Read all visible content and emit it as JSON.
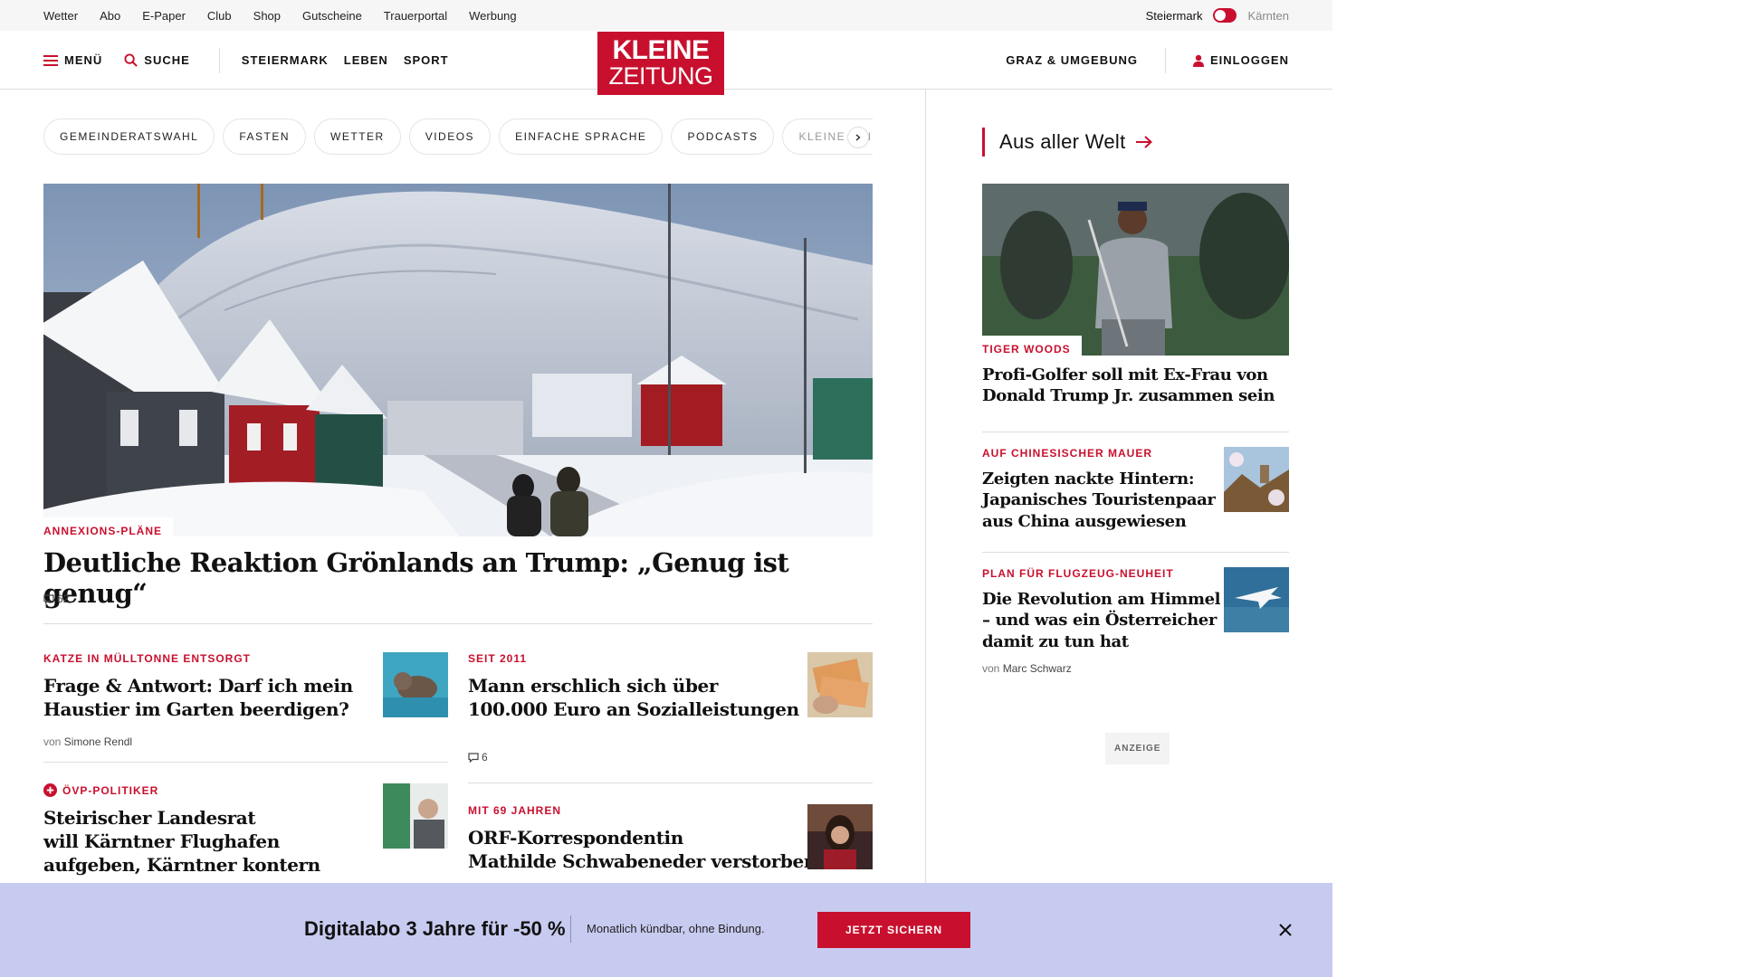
{
  "utility_bar": {
    "links": [
      "Wetter",
      "Abo",
      "E-Paper",
      "Club",
      "Shop",
      "Gutscheine",
      "Trauerportal",
      "Werbung"
    ],
    "region_active": "Steiermark",
    "region_inactive": "Kärnten"
  },
  "nav": {
    "menu": "MENÜ",
    "search": "SUCHE",
    "sections": [
      "STEIERMARK",
      "LEBEN",
      "SPORT"
    ],
    "local": "GRAZ & UMGEBUNG",
    "login": "EINLOGGEN"
  },
  "logo": {
    "line1": "KLEINE",
    "line2": "ZEITUNG",
    "color": "#c8102e"
  },
  "tags": [
    "GEMEINDERATSWAHL",
    "FASTEN",
    "WETTER",
    "VIDEOS",
    "EINFACHE SPRACHE",
    "PODCASTS",
    "KLEINE KINDE"
  ],
  "hero": {
    "kicker": "ANNEXIONS-PLÄNE",
    "title": "Deutliche Reaktion Grönlands an Trump: „Genug ist genug“",
    "comments": "62"
  },
  "teasers": [
    {
      "kicker": "KATZE IN MÜLLTONNE ENTSORGT",
      "title_lines": [
        "Frage & Antwort: Darf ich mein",
        "Haustier im Garten beerdigen?"
      ],
      "by": "von",
      "author": "Simone Rendl"
    },
    {
      "kicker": "SEIT 2011",
      "title_lines": [
        "Mann erschlich sich über",
        "100.000 Euro an Sozialleistungen"
      ],
      "comments": "6"
    },
    {
      "kicker": "ÖVP-POLITIKER",
      "title_lines": [
        "Steirischer Landesrat",
        "will Kärntner Flughafen",
        "aufgeben, Kärntner kontern"
      ]
    },
    {
      "kicker": "MIT 69 JAHREN",
      "title_lines": [
        "ORF-Korrespondentin",
        "Mathilde Schwabeneder verstorben"
      ]
    }
  ],
  "sidebar": {
    "heading": "Aus aller Welt",
    "hero": {
      "kicker": "TIGER WOODS",
      "title_lines": [
        "Profi-Golfer soll mit Ex-Frau von",
        "Donald Trump Jr. zusammen sein"
      ]
    },
    "items": [
      {
        "kicker": "AUF CHINESISCHER MAUER",
        "title_lines": [
          "Zeigten nackte Hintern:",
          "Japanisches Touristenpaar",
          "aus China ausgewiesen"
        ]
      },
      {
        "kicker": "PLAN FÜR FLUGZEUG-NEUHEIT",
        "title_lines": [
          "Die Revolution am Himmel",
          "– und was ein Österreicher",
          "damit zu tun hat"
        ],
        "by": "von",
        "author": "Marc Schwarz"
      }
    ],
    "ad_label": "ANZEIGE"
  },
  "promo": {
    "title": "Digitalabo 3 Jahre für -50 %",
    "subtitle": "Monatlich kündbar, ohne Bindung.",
    "cta": "JETZT SICHERN",
    "background": "#c8cbf0"
  }
}
